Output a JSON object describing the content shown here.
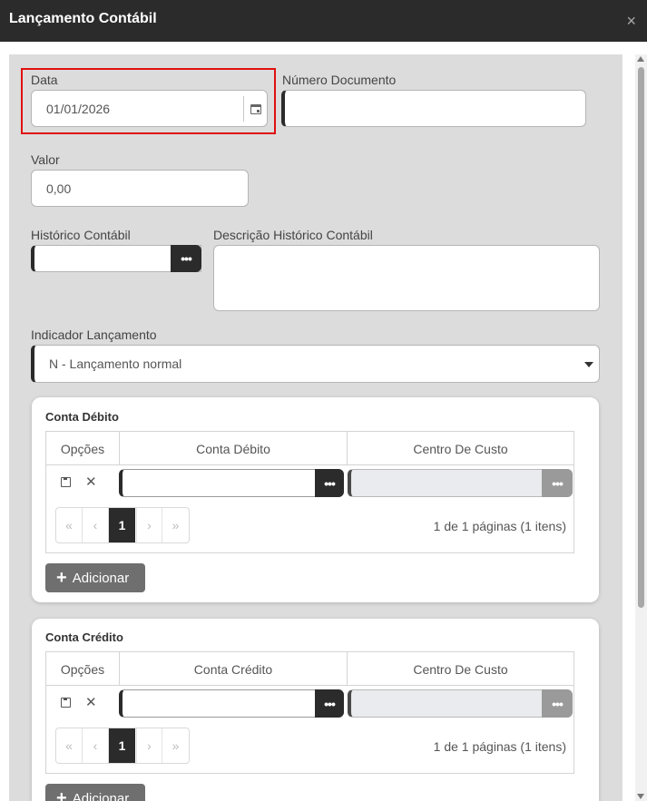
{
  "window": {
    "title": "Lançamento Contábil",
    "close_glyph": "×"
  },
  "form": {
    "data": {
      "label": "Data",
      "value": "01/01/2026",
      "icon": "calendar-icon"
    },
    "numero_documento": {
      "label": "Número Documento",
      "value": ""
    },
    "valor": {
      "label": "Valor",
      "value": "0,00"
    },
    "historico_contabil": {
      "label": "Histórico Contábil",
      "value": "",
      "button": "•••"
    },
    "descricao_historico": {
      "label": "Descrição Histórico Contábil",
      "value": ""
    },
    "indicador_lancamento": {
      "label": "Indicador Lançamento",
      "selected": "N - Lançamento normal"
    }
  },
  "conta_debito": {
    "title": "Conta Débito",
    "columns": [
      "Opções",
      "Conta Débito",
      "Centro De Custo"
    ],
    "row_button": "•••",
    "pager": {
      "first": "«",
      "prev": "‹",
      "page": "1",
      "next": "›",
      "last": "»",
      "info": "1 de 1 páginas (1 itens)"
    },
    "add_label": "Adicionar"
  },
  "conta_credito": {
    "title": "Conta Crédito",
    "columns": [
      "Opções",
      "Conta Crédito",
      "Centro De Custo"
    ],
    "row_button": "•••",
    "pager": {
      "first": "«",
      "prev": "‹",
      "page": "1",
      "next": "›",
      "last": "»",
      "info": "1 de 1 páginas (1 itens)"
    },
    "add_label": "Adicionar"
  },
  "colors": {
    "titlebar": "#2b2b2b",
    "highlight": "#e01010",
    "body": "#dcdcdc"
  }
}
